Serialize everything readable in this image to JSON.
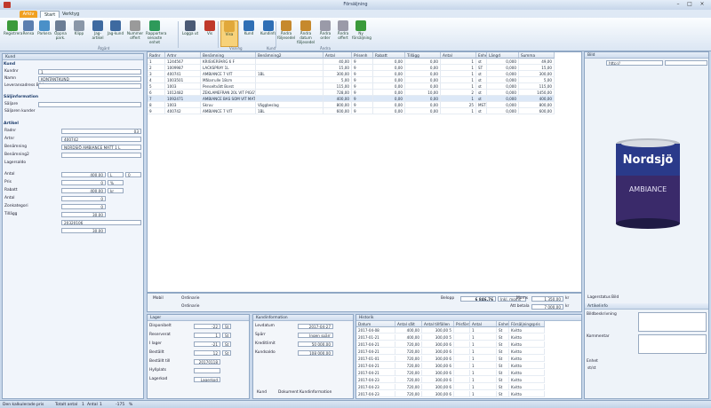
{
  "window": {
    "title": "Försäljning"
  },
  "tabs": {
    "file": "Arkiv",
    "start": "Start",
    "tools": "Verktyg"
  },
  "ribbon": {
    "buttons": [
      "Registrera",
      "Rensa",
      "Parkera",
      "Öppna park.",
      "Klipp",
      "Jag-artikel",
      "Jag-kund",
      "Nummer offert",
      "Rapportera senaste enhet",
      "Logga ut",
      "Vis",
      "Visa",
      "Kund",
      "Kundinfo",
      "Ändra följesedel",
      "Ändra datum följesedel",
      "Ändra order",
      "Ändra offert",
      "Ny försäljning"
    ],
    "groups": [
      "Åtgärd",
      "Visning",
      "Kund",
      "Ändra"
    ]
  },
  "left": {
    "header": "Kund",
    "s1": "Kund",
    "kundnr_label": "Kundnr",
    "kundnr": "1",
    "namn_label": "Namn",
    "namn": "KONTANTKUND",
    "lev_label": "Leveransadress Bild",
    "s2": "Säljinformation",
    "saljare_label": "Säljare",
    "sj_label": "Säljaren kunder",
    "s3": "Artikel",
    "radnr_label": "Radnr",
    "radnr": "03",
    "artnr_label": "Artnr",
    "artnr": "400742",
    "ben_label": "Benämning",
    "ben": "NORDSJÖ AMBIANCE MATT 1 L",
    "ben2_label": "Benämning2",
    "lager_label": "Lagersaldo",
    "antal_label": "Antal",
    "antal": "400,00",
    "enh1": "L",
    "enh2": "0",
    "pris_label": "Pris",
    "pris": "0",
    "pct": "%",
    "rab_label": "Rabatt",
    "rab": "400,00",
    "kr": "kr",
    "ant2_label": "Antal",
    "ant2": "0",
    "zon_label": "Zonkategori",
    "zon": "0",
    "till_label": "Tillägg",
    "till": "30,00",
    "ref": "20320106",
    "rs": "30,00"
  },
  "grid": {
    "headers": [
      "Radnr",
      "Artnr",
      "Benämning",
      "Benämning2",
      "Antal",
      "Prisenh",
      "Rabatt",
      "Tillägg",
      "Antal",
      "Enhet",
      "Längd",
      "Summa"
    ],
    "rows": [
      [
        "1",
        "1244567",
        "KRISVERFARG 6 F",
        "",
        "40,00",
        "9",
        "0,00",
        "0,00",
        "1",
        "st",
        "0,000",
        "49,00"
      ],
      [
        "2",
        "1009987",
        "LACKSPRAY 1L",
        "",
        "15,00",
        "9",
        "0,00",
        "0,00",
        "1",
        "ST",
        "0,000",
        "15,00"
      ],
      [
        "3",
        "400741",
        "AMBIANCE 7 VIT",
        "1BL",
        "300,00",
        "9",
        "0,00",
        "0,00",
        "1",
        "st",
        "0,000",
        "300,00"
      ],
      [
        "4",
        "1003501",
        "Målarrulle 18cm",
        "",
        "5,00",
        "9",
        "0,00",
        "0,00",
        "1",
        "st",
        "0,000",
        "5,00"
      ],
      [
        "5",
        "1003",
        "Penseltvätt Borst",
        "",
        "115,00",
        "9",
        "0,00",
        "0,00",
        "1",
        "st",
        "0,000",
        "115,00"
      ],
      [
        "6",
        "1012482",
        "ZEKLAMEFRAN 20L VIT PIGGY",
        "",
        "728,00",
        "9",
        "0,00",
        "10,00",
        "2",
        "st",
        "0,000",
        "1450,00"
      ],
      [
        "7",
        "1092471",
        "AMBIANCE BAS SOM VIT MATT 1L",
        "",
        "400,00",
        "9",
        "0,00",
        "0,00",
        "1",
        "st",
        "0,000",
        "400,00"
      ],
      [
        "8",
        "1003",
        "Skruv",
        "Väggbeslag",
        "800,00",
        "9",
        "0,00",
        "0,00",
        "25",
        "MST",
        "0,000",
        "800,00"
      ],
      [
        "9",
        "400742",
        "AMBIANCE 7 VIT",
        "1BL",
        "600,00",
        "9",
        "0,00",
        "0,00",
        "1",
        "st",
        "0,000",
        "600,00"
      ]
    ]
  },
  "totals": {
    "radio1": "Mobil",
    "radio2": "Ordinarie",
    "radio3": "Ordinarie",
    "summa_label": "Belopp",
    "summa": "6 846,76",
    "ink": "Inkl. moms",
    "m_label": "Moms",
    "moms": "1 350,00",
    "kr": "kr",
    "rest_label": "Att betala",
    "rest": "7 000,00",
    "kr2": "kr"
  },
  "lager": {
    "title": "Lager",
    "rows": [
      [
        "Disponibelt",
        "-22",
        "St"
      ],
      [
        "Reserverat",
        "1",
        "St"
      ],
      [
        "I lager",
        "-21",
        "St"
      ],
      [
        "Beställt",
        "12",
        "St"
      ],
      [
        "Beställt till",
        "20170118",
        ""
      ],
      [
        "Hyllplats",
        "",
        ""
      ],
      [
        "Lagerkod",
        "Lagerkod",
        ""
      ]
    ]
  },
  "kund": {
    "title": "Kundinformation",
    "rows": [
      [
        "Levdatum",
        "2017-04-27"
      ],
      [
        "Spärr",
        "Ingen spärr"
      ],
      [
        "Kreditlimit",
        "50 000,00"
      ],
      [
        "Kundsaldo",
        "108 000,00"
      ]
    ],
    "tabs": [
      "Kund",
      "Dokument",
      "Kundinformation"
    ]
  },
  "hist": {
    "title": "Historik",
    "headers": [
      "Datum",
      "Antal sålt",
      "Antal tillfällen",
      "Prisförd",
      "Antal",
      "Enhet",
      "Försäljningspris"
    ],
    "rows": [
      [
        "2017-04-08",
        "400,00",
        "300,00 5",
        "",
        "1",
        "St",
        "Kvitto"
      ],
      [
        "2017-01-21",
        "400,00",
        "300,00 5",
        "",
        "1",
        "St",
        "Kvitto"
      ],
      [
        "2017-04-21",
        "720,00",
        "300,00 6",
        "",
        "1",
        "St",
        "Kvitto"
      ],
      [
        "2017-04-21",
        "720,00",
        "300,00 6",
        "",
        "1",
        "St",
        "Kvitto"
      ],
      [
        "2017-01-01",
        "720,00",
        "300,00 6",
        "",
        "1",
        "St",
        "Kvitto"
      ],
      [
        "2017-04-21",
        "720,00",
        "300,00 6",
        "",
        "1",
        "St",
        "Kvitto"
      ],
      [
        "2017-04-21",
        "720,00",
        "300,00 6",
        "",
        "1",
        "St",
        "Kvitto"
      ],
      [
        "2017-04-23",
        "720,00",
        "300,00 6",
        "",
        "1",
        "St",
        "Kvitto"
      ],
      [
        "2017-04-23",
        "720,00",
        "300,00 6",
        "",
        "1",
        "St",
        "Kvitto"
      ],
      [
        "2017-04-23",
        "720,00",
        "300,00 6",
        "",
        "1",
        "St",
        "Kvitto"
      ]
    ]
  },
  "right": {
    "header": "Bild",
    "tab1": "Lagerstatus",
    "tab2": "Bild",
    "info": "Artikelinfo",
    "f1": "Bildbeskrivning",
    "f2": "Kommentar",
    "f3": "Enhet",
    "f3v": "st/st",
    "url": "http://",
    "brand": "Nordsjö",
    "product": "AMBIANCE"
  },
  "status": {
    "s1": "Den kalkulerade pris",
    "s2": "Totalt antal",
    "s2v": "1",
    "s3": "Antal",
    "s3v": "1",
    "s4": "-175",
    "s5": "%"
  }
}
